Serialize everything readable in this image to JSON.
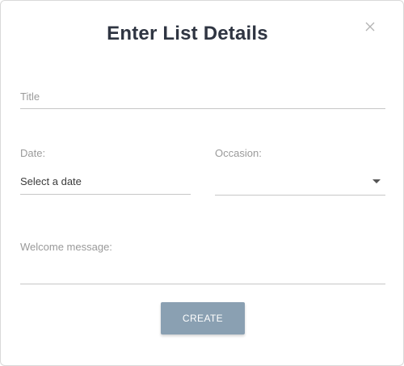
{
  "dialog": {
    "title": "Enter List Details",
    "close_icon": "close-icon"
  },
  "form": {
    "title_placeholder": "Title",
    "date_label": "Date:",
    "date_value": "Select a date",
    "occasion_label": "Occasion:",
    "occasion_value": "",
    "welcome_label": "Welcome message:",
    "welcome_value": ""
  },
  "actions": {
    "create_label": "CREATE"
  },
  "colors": {
    "title_text": "#2f3542",
    "button_bg": "#8aa0b2",
    "button_text": "#ffffff",
    "underline": "#c7c7c7",
    "muted_text": "#9a9a9a"
  }
}
